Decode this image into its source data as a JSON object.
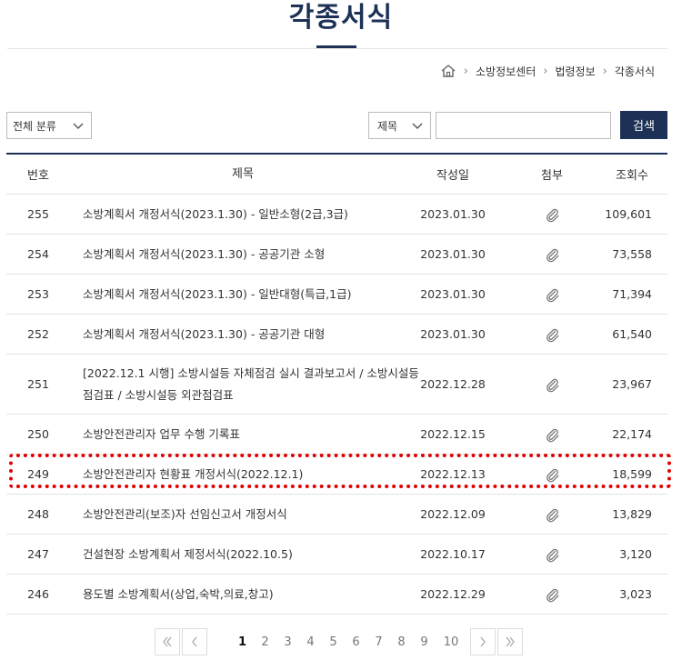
{
  "page_title": "각종서식",
  "breadcrumb": [
    "소방정보센터",
    "법령정보",
    "각종서식"
  ],
  "filters": {
    "category_label": "전체 분류",
    "search_field_label": "제목",
    "search_value": "",
    "search_button": "검색"
  },
  "table": {
    "headers": {
      "number": "번호",
      "title": "제목",
      "date": "작성일",
      "attachment": "첨부",
      "views": "조회수"
    },
    "rows": [
      {
        "number": "255",
        "title": "소방계획서 개정서식(2023.1.30) - 일반소형(2급,3급)",
        "date": "2023.01.30",
        "views": "109,601"
      },
      {
        "number": "254",
        "title": "소방계획서 개정서식(2023.1.30) - 공공기관 소형",
        "date": "2023.01.30",
        "views": "73,558"
      },
      {
        "number": "253",
        "title": "소방계획서 개정서식(2023.1.30) - 일반대형(특급,1급)",
        "date": "2023.01.30",
        "views": "71,394"
      },
      {
        "number": "252",
        "title": "소방계획서 개정서식(2023.1.30) - 공공기관 대형",
        "date": "2023.01.30",
        "views": "61,540"
      },
      {
        "number": "251",
        "title": "[2022.12.1 시행] 소방시설등 자체점검 실시 결과보고서 / 소방시설등 점검표 / 소방시설등 외관점검표",
        "date": "2022.12.28",
        "views": "23,967"
      },
      {
        "number": "250",
        "title": "소방안전관리자 업무 수행 기록표",
        "date": "2022.12.15",
        "views": "22,174"
      },
      {
        "number": "249",
        "title": "소방안전관리자 현황표 개정서식(2022.12.1)",
        "date": "2022.12.13",
        "views": "18,599"
      },
      {
        "number": "248",
        "title": "소방안전관리(보조)자 선임신고서 개정서식",
        "date": "2022.12.09",
        "views": "13,829"
      },
      {
        "number": "247",
        "title": "건설현장 소방계획서 제정서식(2022.10.5)",
        "date": "2022.10.17",
        "views": "3,120"
      },
      {
        "number": "246",
        "title": "용도별 소방계획서(상업,숙박,의료,창고)",
        "date": "2022.12.29",
        "views": "3,023"
      }
    ]
  },
  "pagination": {
    "pages": [
      "1",
      "2",
      "3",
      "4",
      "5",
      "6",
      "7",
      "8",
      "9",
      "10"
    ],
    "current": "1"
  },
  "icons": {
    "home": "home-icon",
    "attachment": "paperclip-icon",
    "first": "double-chevron-left-icon",
    "prev": "chevron-left-icon",
    "next": "chevron-right-icon",
    "last": "double-chevron-right-icon"
  },
  "colors": {
    "brand": "#1d3157",
    "highlight": "#e00000"
  }
}
